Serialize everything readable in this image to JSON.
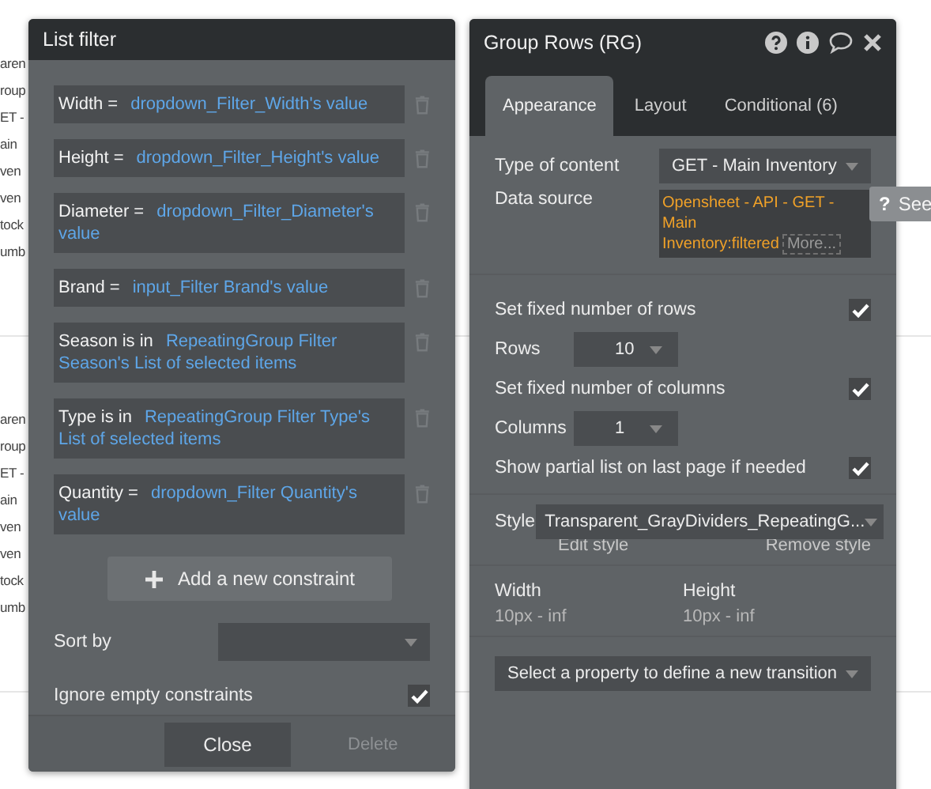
{
  "background_page": {
    "lines_top": [
      "aren",
      "roup",
      "ET -",
      "ain",
      "ven",
      "ven",
      "tock",
      "umb"
    ],
    "lines_bottom": [
      "aren",
      "roup",
      "ET -",
      "ain",
      "ven",
      "ven",
      "tock",
      "umb"
    ]
  },
  "list_filter": {
    "title": "List filter",
    "constraints": [
      {
        "label": "Width =",
        "value": "dropdown_Filter_Width's value"
      },
      {
        "label": "Height =",
        "value": "dropdown_Filter_Height's value"
      },
      {
        "label": "Diameter =",
        "value": "dropdown_Filter_Diameter's value"
      },
      {
        "label": "Brand =",
        "value": "input_Filter Brand's value"
      },
      {
        "label": "Season is in",
        "value": "RepeatingGroup Filter Season's List of selected items"
      },
      {
        "label": "Type is in",
        "value": "RepeatingGroup Filter Type's List of selected items"
      },
      {
        "label": "Quantity =",
        "value": "dropdown_Filter Quantity's value"
      }
    ],
    "add_button": "Add a new constraint",
    "sort_by": {
      "label": "Sort by"
    },
    "ignore_empty": {
      "label": "Ignore empty constraints",
      "checked": true
    },
    "close_button": "Close",
    "delete_button": {
      "label": "Delete",
      "disabled": true
    }
  },
  "group_rows": {
    "title": "Group Rows (RG)",
    "tabs": [
      {
        "label": "Appearance",
        "selected": true
      },
      {
        "label": "Layout",
        "selected": false
      },
      {
        "label": "Conditional (6)",
        "selected": false
      }
    ],
    "type_of_content": {
      "label": "Type of content",
      "value": "GET - Main Inventory"
    },
    "data_source": {
      "label": "Data source",
      "value": "Opensheet - API - GET - Main Inventory:filtered",
      "more": "More..."
    },
    "options": [
      {
        "kind": "check",
        "label": "Set fixed number of rows",
        "checked": true
      },
      {
        "kind": "select",
        "label": "Rows",
        "value": "10"
      },
      {
        "kind": "check",
        "label": "Set fixed number of columns",
        "checked": true
      },
      {
        "kind": "select",
        "label": "Columns",
        "value": "1"
      },
      {
        "kind": "check",
        "label": "Show partial list on last page if needed",
        "checked": true
      }
    ],
    "style": {
      "label": "Style",
      "value": "Transparent_GrayDividers_RepeatingG...",
      "edit": "Edit style",
      "remove": "Remove style"
    },
    "sizes": [
      {
        "label": "Width",
        "value": "10px - inf"
      },
      {
        "label": "Height",
        "value": "10px - inf"
      }
    ],
    "transition": {
      "placeholder": "Select a property to define a new transition"
    }
  },
  "tooltip": {
    "icon": "?",
    "text": "See"
  }
}
